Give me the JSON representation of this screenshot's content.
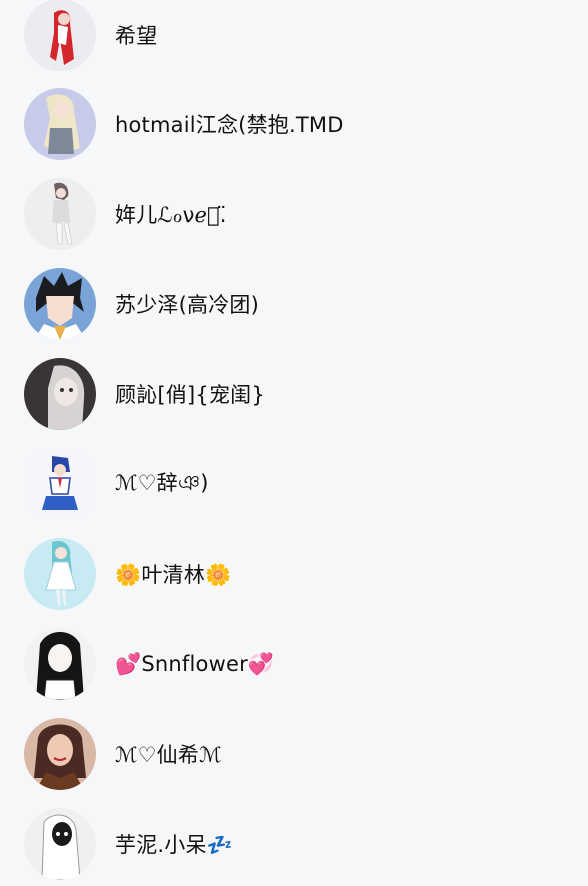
{
  "contacts": [
    {
      "name": "希望",
      "avatar_icon": "avatar-red-hair-girl",
      "bg": "#ecebef"
    },
    {
      "name": "hotmail江念(禁抱.TMD",
      "avatar_icon": "avatar-blonde-girl",
      "bg": "#c7cbe9"
    },
    {
      "name": "姩儿ℒℴνℯ͛.̈",
      "avatar_icon": "avatar-standing-girl",
      "bg": "#eeeeee"
    },
    {
      "name": "苏少泽(高冷团)",
      "avatar_icon": "avatar-anime-boy",
      "bg": "#7aa4d8"
    },
    {
      "name": "顾訫[俏]{宠闺}",
      "avatar_icon": "avatar-dark-girl",
      "bg": "#3a3535"
    },
    {
      "name": "ℳ♡辞ঞ)",
      "avatar_icon": "avatar-blue-boy",
      "bg": "#f4f6fb"
    },
    {
      "name": "🌼叶清林🌼",
      "avatar_icon": "avatar-teal-girl",
      "bg": "#c8eaf2"
    },
    {
      "name": "💕Snnflower💞",
      "avatar_icon": "avatar-maid-girl",
      "bg": "#f2f2f2"
    },
    {
      "name": "ℳ♡仙希ℳ",
      "avatar_icon": "avatar-portrait-woman",
      "bg": "#d9b8a6"
    },
    {
      "name": "芋泥.小呆💤",
      "avatar_icon": "avatar-sketch-figure",
      "bg": "#f0f0f0"
    }
  ]
}
